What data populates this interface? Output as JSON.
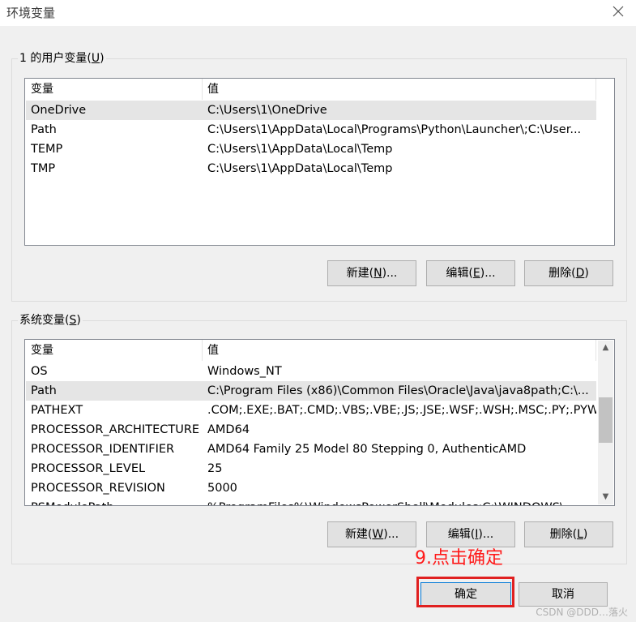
{
  "window": {
    "title": "环境变量",
    "close_icon": "close-icon"
  },
  "user_vars": {
    "group_title_prefix": "1 的用户变量(",
    "group_title_accel": "U",
    "group_title_suffix": ")",
    "columns": [
      "变量",
      "值"
    ],
    "rows": [
      {
        "name": "OneDrive",
        "value": "C:\\Users\\1\\OneDrive",
        "selected": true
      },
      {
        "name": "Path",
        "value": "C:\\Users\\1\\AppData\\Local\\Programs\\Python\\Launcher\\;C:\\User...",
        "selected": false
      },
      {
        "name": "TEMP",
        "value": "C:\\Users\\1\\AppData\\Local\\Temp",
        "selected": false
      },
      {
        "name": "TMP",
        "value": "C:\\Users\\1\\AppData\\Local\\Temp",
        "selected": false
      }
    ],
    "buttons": {
      "new_prefix": "新建(",
      "new_accel": "N",
      "new_suffix": ")...",
      "edit_prefix": "编辑(",
      "edit_accel": "E",
      "edit_suffix": ")...",
      "delete_prefix": "删除(",
      "delete_accel": "D",
      "delete_suffix": ")"
    }
  },
  "system_vars": {
    "group_title_prefix": "系统变量(",
    "group_title_accel": "S",
    "group_title_suffix": ")",
    "columns": [
      "变量",
      "值"
    ],
    "rows": [
      {
        "name": "OS",
        "value": "Windows_NT",
        "selected": false
      },
      {
        "name": "Path",
        "value": "C:\\Program Files (x86)\\Common Files\\Oracle\\Java\\java8path;C:\\...",
        "selected": true
      },
      {
        "name": "PATHEXT",
        "value": ".COM;.EXE;.BAT;.CMD;.VBS;.VBE;.JS;.JSE;.WSF;.WSH;.MSC;.PY;.PYW",
        "selected": false
      },
      {
        "name": "PROCESSOR_ARCHITECTURE",
        "value": "AMD64",
        "selected": false
      },
      {
        "name": "PROCESSOR_IDENTIFIER",
        "value": "AMD64 Family 25 Model 80 Stepping 0, AuthenticAMD",
        "selected": false
      },
      {
        "name": "PROCESSOR_LEVEL",
        "value": "25",
        "selected": false
      },
      {
        "name": "PROCESSOR_REVISION",
        "value": "5000",
        "selected": false
      },
      {
        "name": "PSModulePath",
        "value": "%ProgramFiles%\\WindowsPowerShell\\Modules;C:\\WINDOWS\\...",
        "selected": false
      }
    ],
    "buttons": {
      "new_prefix": "新建(",
      "new_accel": "W",
      "new_suffix": ")...",
      "edit_prefix": "编辑(",
      "edit_accel": "I",
      "edit_suffix": ")...",
      "delete_prefix": "删除(",
      "delete_accel": "L",
      "delete_suffix": ")"
    }
  },
  "footer": {
    "ok_label": "确定",
    "cancel_label": "取消"
  },
  "annotation": {
    "text": "9.点击确定",
    "color": "#ff1a1a"
  },
  "watermark": "CSDN @DDD…落火"
}
